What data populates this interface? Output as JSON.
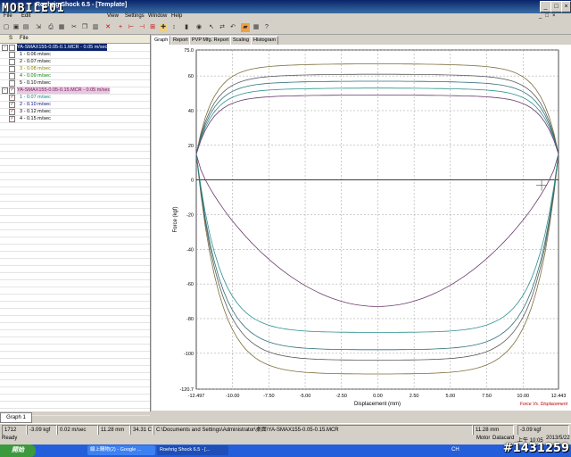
{
  "window": {
    "title": "Roehrig Shock 6.5 - [Template]",
    "logo": "MOBILE01"
  },
  "menu": [
    "File",
    "Edit",
    "View",
    "Settings",
    "Window",
    "Help"
  ],
  "window_buttons": [
    "_",
    "□",
    "×"
  ],
  "file_panel": {
    "header_s": "S",
    "header_file": "File",
    "rows": [
      {
        "label": "YA-SMAX155-0.05-0.1.MCR - 0.05 m/sec",
        "checked": false,
        "selected": true,
        "indent": 0,
        "color": "#ffffff"
      },
      {
        "label": "1 - 0.06 m/sec",
        "checked": false,
        "selected": false,
        "indent": 1,
        "color": "#000000"
      },
      {
        "label": "2 - 0.07 m/sec",
        "checked": false,
        "selected": false,
        "indent": 1,
        "color": "#000000"
      },
      {
        "label": "3 - 0.08 m/sec",
        "checked": false,
        "selected": false,
        "indent": 1,
        "color": "#808000"
      },
      {
        "label": "4 - 0.09 m/sec",
        "checked": false,
        "selected": false,
        "indent": 1,
        "color": "#008000"
      },
      {
        "label": "5 - 0.10 m/sec",
        "checked": false,
        "selected": false,
        "indent": 1,
        "color": "#000000"
      },
      {
        "label": "YA-SMAX155-0.05-0.15.MCR - 0.05 m/sec",
        "checked": true,
        "selected": false,
        "indent": 0,
        "color": "#7b2060"
      },
      {
        "label": "1 - 0.07 m/sec",
        "checked": true,
        "selected": false,
        "indent": 1,
        "color": "#008080"
      },
      {
        "label": "2 - 0.10 m/sec",
        "checked": true,
        "selected": false,
        "indent": 1,
        "color": "#000080"
      },
      {
        "label": "3 - 0.12 m/sec",
        "checked": true,
        "selected": false,
        "indent": 1,
        "color": "#000000"
      },
      {
        "label": "4 - 0.15 m/sec",
        "checked": true,
        "selected": false,
        "indent": 1,
        "color": "#000000"
      }
    ]
  },
  "tabs": [
    "Graph",
    "Report",
    "PVP Mfg. Report",
    "Scaling",
    "Histogram"
  ],
  "bottom_tab": "Graph 1",
  "chart_data": {
    "type": "line",
    "xlabel": "Displacement (mm)",
    "ylabel": "Force (kgf)",
    "xlim": [
      -12.497,
      12.443
    ],
    "ylim": [
      -120.7,
      75.0
    ],
    "x_ticks": [
      -10.0,
      -7.5,
      -5.0,
      -2.5,
      0.0,
      2.5,
      5.0,
      7.5,
      10.0
    ],
    "x_tick_labels": [
      "-10.00",
      "-7.50",
      "-5.00",
      "-2.50",
      "0.00",
      "2.50",
      "5.00",
      "7.50",
      "10.00"
    ],
    "x_edge_labels": [
      "-12.497",
      "12.443"
    ],
    "y_ticks": [
      75,
      60,
      40,
      20,
      0,
      -20,
      -40,
      -60,
      -80,
      -100,
      -120.7
    ],
    "y_tick_labels": [
      "75.0",
      "60",
      "40",
      "20",
      "0",
      "-20",
      "-40",
      "-60",
      "-80",
      "-100",
      "-120.7"
    ],
    "grid": true,
    "corner_note": "Force Vs. Displacement",
    "series": [
      {
        "color": "#7b6e3a",
        "top": 67,
        "bottom": -112,
        "rise": 0.85
      },
      {
        "color": "#5a5a5a",
        "top": 61,
        "bottom": -104,
        "rise": 0.85
      },
      {
        "color": "#2e6e7a",
        "top": 57,
        "bottom": -98,
        "rise": 0.85
      },
      {
        "color": "#2f8f8f",
        "top": 53,
        "bottom": -88,
        "rise": 0.85
      },
      {
        "color": "#6b3a6b",
        "top": 49,
        "bottom": -73,
        "rise": 0.35
      }
    ]
  },
  "status": {
    "count": "1712",
    "force": "-3.09 kgf",
    "vel": "0.02 m/sec",
    "disp": "11.28 mm",
    "temp": "34.31 C",
    "path": "C:\\Documents and Settings\\Administrator\\桌面\\YA-SMAX155-0.05-0.15.MCR",
    "disp2": "11.28 mm",
    "force2": "-3.09 kgf"
  },
  "ready": {
    "text": "Ready",
    "motor": "Motor",
    "datacard": "Datacard",
    "time": "上午 10:05",
    "date": "2013/5/22"
  },
  "taskbar": {
    "start": "開始",
    "tasks": [
      "線上購物(2) - Google ...",
      "Roehrig Shock 6.5 - [..."
    ],
    "tray": "CH"
  },
  "watermark": "#1431259"
}
